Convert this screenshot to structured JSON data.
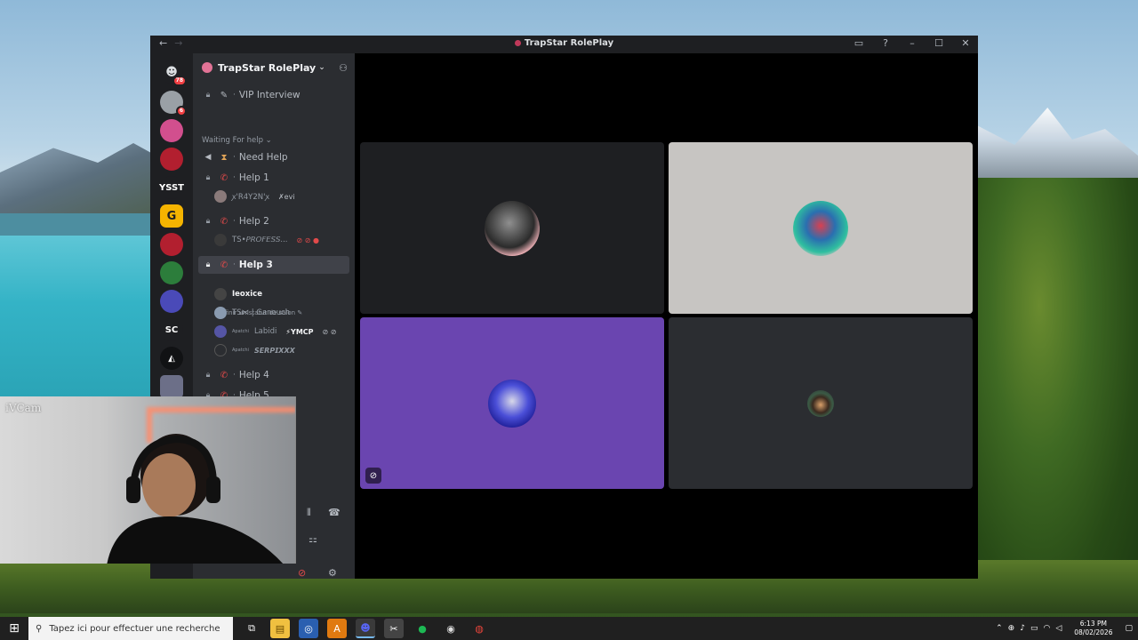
{
  "window": {
    "title": "TrapStar RolePlay",
    "nav_back": "←",
    "nav_forward": "→"
  },
  "rail": {
    "items": [
      {
        "name": "home",
        "badge": "78",
        "color": "#5865f2"
      },
      {
        "name": "server-2",
        "badge": "6",
        "color": "#9aa0a6"
      },
      {
        "name": "server-3",
        "badge": "",
        "color": "#d24f8e"
      },
      {
        "name": "server-4",
        "badge": "",
        "color": "#b21f2f"
      },
      {
        "name": "server-ysst",
        "text": "YSST",
        "color": "#1e1f22"
      },
      {
        "name": "server-6",
        "text": "G",
        "color": "#f5b400"
      },
      {
        "name": "server-7",
        "badge": "",
        "color": "#b21f2f"
      },
      {
        "name": "server-8",
        "badge": "",
        "color": "#2c7d3b"
      },
      {
        "name": "server-9",
        "badge": "",
        "color": "#4a4ab8"
      },
      {
        "name": "server-sc",
        "text": "SC",
        "color": "#1e1f22"
      },
      {
        "name": "server-11",
        "text": "◭",
        "color": "#111214"
      },
      {
        "name": "server-12",
        "badge": "",
        "color": "#6c6f88"
      }
    ]
  },
  "server": {
    "name": "TrapStar RolePlay",
    "chevron": "⌄"
  },
  "channels": {
    "vip": "VIP Interview",
    "category": "Waiting For help",
    "category_chevron": "⌄",
    "need_help": "Need Help",
    "help1": "Help 1",
    "help2": "Help 2",
    "help3": "Help 3",
    "help3_status": "Définir un statut de salon ✎",
    "help4": "Help 4",
    "help5": "Help 5"
  },
  "members": {
    "h1_m1": "ꭗ'R4Y2N'ꭗ",
    "h1_m1_tag": "✗evi",
    "h2_m1": "TS•𝘗𝘙𝘖𝘍𝘌𝘚𝘚...",
    "h3_m1": "Ιeoxice",
    "h3_m2": "TS⋈ | Ganouch",
    "h3_m3": "Labidi",
    "h3_m3_prefix": "Apatchi",
    "h3_m3_tag": "⚡YMCP",
    "h3_m4": "𝙎𝙀𝙍𝙋𝙄𝙓𝙓𝙓",
    "h3_m4_prefix": "Apatchi"
  },
  "call": {
    "tiles": [
      {
        "name": "tile-1",
        "bg": "#1e1f22"
      },
      {
        "name": "tile-2",
        "bg": "#c7c5c2"
      },
      {
        "name": "tile-3",
        "bg": "#6a45b0"
      },
      {
        "name": "tile-4",
        "bg": "#2b2d31"
      }
    ]
  },
  "cam": {
    "label": "iVCam"
  },
  "taskbar": {
    "search_placeholder": "Tapez ici pour effectuer une recherche",
    "time": "6:13 PM",
    "date": "08/02/2026",
    "apps": [
      "task-view",
      "file-explorer",
      "steam",
      "avast",
      "discord",
      "cap-app",
      "spotify",
      "obs",
      "chrome"
    ]
  }
}
